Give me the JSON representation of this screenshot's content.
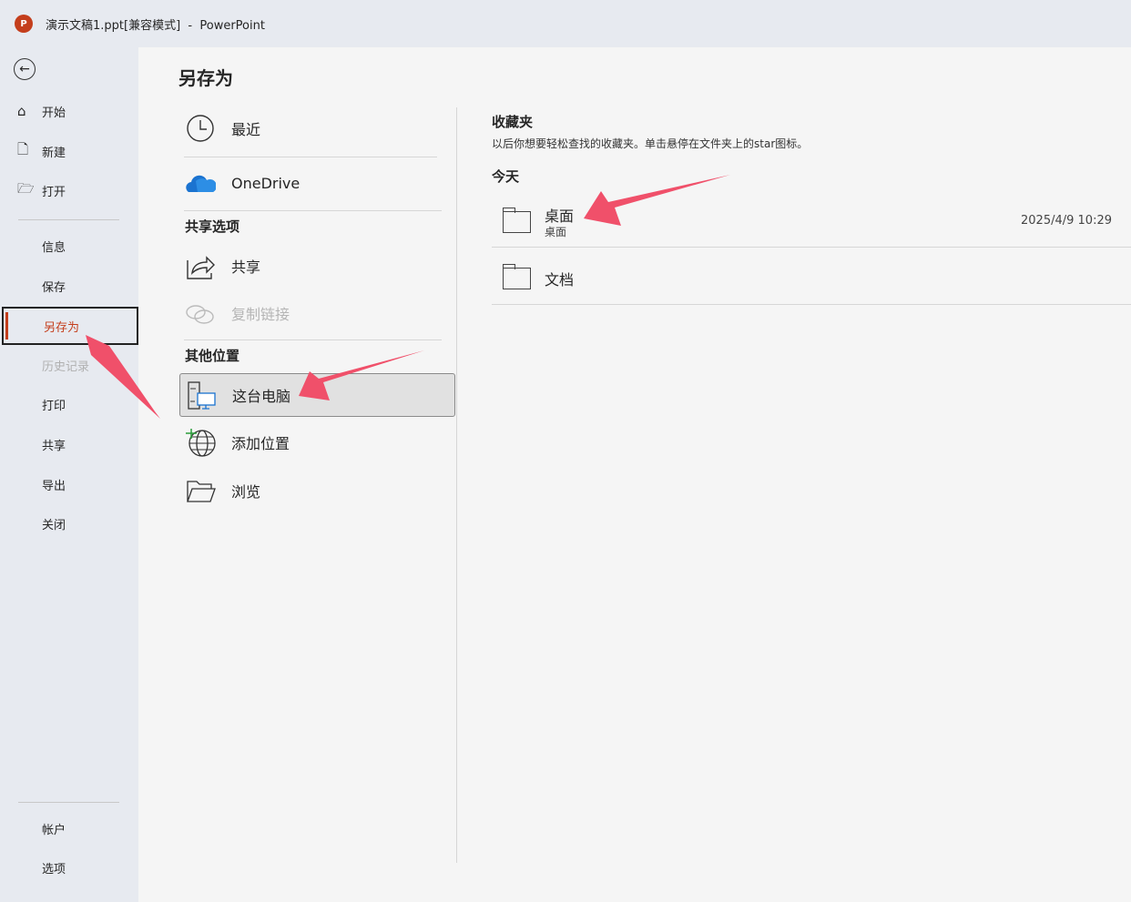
{
  "titlebar": {
    "title": "演示文稿1.ppt[兼容模式]  -  PowerPoint",
    "logo": "P"
  },
  "sidebar": {
    "items": [
      {
        "label": "开始",
        "icon": "home-icon"
      },
      {
        "label": "新建",
        "icon": "new-doc-icon"
      },
      {
        "label": "打开",
        "icon": "folder-open-icon"
      },
      {
        "label": "信息"
      },
      {
        "label": "保存"
      },
      {
        "label": "另存为"
      },
      {
        "label": "历史记录"
      },
      {
        "label": "打印"
      },
      {
        "label": "共享"
      },
      {
        "label": "导出"
      },
      {
        "label": "关闭"
      }
    ],
    "bottom": [
      {
        "label": "帐户"
      },
      {
        "label": "选项"
      }
    ]
  },
  "main": {
    "title": "另存为",
    "locations": {
      "recent": "最近",
      "onedrive": "OneDrive",
      "share_section": "共享选项",
      "share": "共享",
      "copy_link": "复制链接",
      "other_section": "其他位置",
      "this_pc": "这台电脑",
      "add_place": "添加位置",
      "browse": "浏览"
    },
    "favorites": {
      "title": "收藏夹",
      "hint": "以后你想要轻松查找的收藏夹。单击悬停在文件夹上的star图标。",
      "today": "今天",
      "items": [
        {
          "name": "桌面",
          "path": "桌面",
          "date": "2025/4/9 10:29"
        },
        {
          "name": "文档"
        }
      ]
    }
  },
  "colors": {
    "accent": "#c43e1c",
    "annotation": "#f0506a"
  }
}
